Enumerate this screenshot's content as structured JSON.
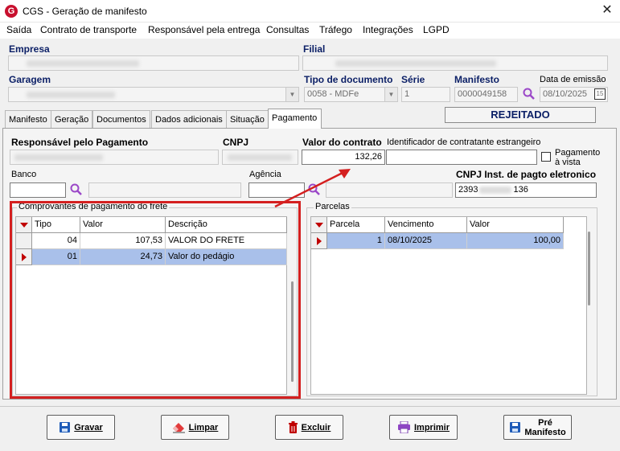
{
  "window": {
    "title": "CGS - Geração de manifesto",
    "app_icon": "G",
    "close": "✕"
  },
  "menu": {
    "items": [
      "Saída",
      "Contrato de transporte",
      "Responsável pela entrega",
      "Consultas",
      "Tráfego",
      "Integrações",
      "LGPD"
    ]
  },
  "header": {
    "empresa_label": "Empresa",
    "filial_label": "Filial",
    "garagem_label": "Garagem",
    "tipo_doc_label": "Tipo de documento",
    "tipo_doc_value": "0058 - MDFe",
    "serie_label": "Série",
    "serie_value": "1",
    "manifesto_label": "Manifesto",
    "manifesto_value": "0000049158",
    "data_emissao_label": "Data de emissão",
    "data_emissao_value": "08/10/2025",
    "calendar_icon_text": "15"
  },
  "status": {
    "text": "REJEITADO"
  },
  "tabs": [
    "Manifesto",
    "Geração",
    "Documentos",
    "Dados adicionais",
    "Situação",
    "Pagamento"
  ],
  "payment": {
    "responsavel_label": "Responsável pelo Pagamento",
    "cnpj_label": "CNPJ",
    "valor_contrato_label": "Valor do contrato",
    "valor_contrato_value": "132,26",
    "identificador_label": "Identificador de contratante estrangeiro",
    "pagamento_vista_label": "Pagamento à vista",
    "banco_label": "Banco",
    "agencia_label": "Agência",
    "cnpj_inst_label": "CNPJ Inst. de pagto eletronico",
    "cnpj_inst_value_start": "2393",
    "cnpj_inst_value_end": "136"
  },
  "comprovantes": {
    "title": "Comprovantes de pagamento do frete",
    "headers": {
      "tipo": "Tipo",
      "valor": "Valor",
      "descricao": "Descrição"
    },
    "rows": [
      {
        "tipo": "04",
        "valor": "107,53",
        "descricao": "VALOR DO FRETE"
      },
      {
        "tipo": "01",
        "valor": "24,73",
        "descricao": "Valor do pedágio"
      }
    ]
  },
  "parcelas": {
    "title": "Parcelas",
    "headers": {
      "parcela": "Parcela",
      "vencimento": "Vencimento",
      "valor": "Valor"
    },
    "rows": [
      {
        "parcela": "1",
        "vencimento": "08/10/2025",
        "valor": "100,00"
      }
    ]
  },
  "buttons": {
    "gravar": "Gravar",
    "limpar": "Limpar",
    "excluir": "Excluir",
    "imprimir": "Imprimir",
    "pre_manifesto_1": "Pré",
    "pre_manifesto_2": "Manifesto"
  },
  "colors": {
    "label_blue": "#0b1f66",
    "highlight_red": "#d42020",
    "selected_row": "#a9c0ea",
    "app_red": "#c8102e"
  }
}
